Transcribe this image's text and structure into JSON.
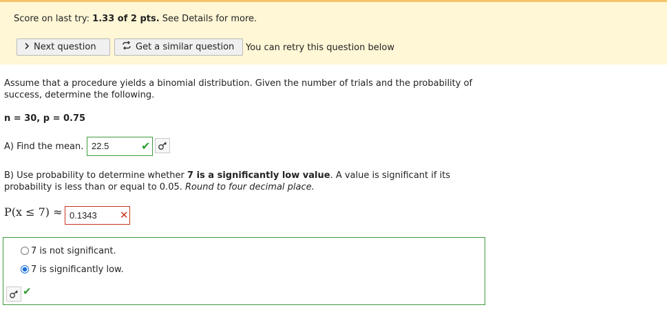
{
  "banner": {
    "score_prefix": "Score on last try:",
    "score_value": "1.33 of 2 pts.",
    "score_suffix": "See Details for more.",
    "next_label": "Next question",
    "similar_label": "Get a similar question",
    "retry_text": "You can retry this question below"
  },
  "question": {
    "intro": "Assume that a procedure yields a binomial distribution. Given the number of trials and the probability of success, determine the following.",
    "params": "n = 30, p = 0.75",
    "partA_label": "A) Find the mean.",
    "partA_value": "22.5",
    "partB_prefix": "B) Use probability to determine whether ",
    "partB_bold": "7 is a significantly low value",
    "partB_mid": ". A value is significant if its probability is less than or equal to 0.05. ",
    "partB_italic": "Round to four decimal place.",
    "prob_expr": "P(x ≤ 7) ≈",
    "partB_value": "0.1343",
    "choices": [
      {
        "label": "7 is not significant.",
        "selected": false
      },
      {
        "label": "7 is significantly low.",
        "selected": true
      }
    ]
  },
  "colors": {
    "correct": "#3b9a3b",
    "incorrect": "#c8331f",
    "banner": "#fff7d6"
  },
  "icons": {
    "next": "chevron-right-icon",
    "similar": "refresh-icon",
    "key": "key-icon",
    "check": "check-icon",
    "cross": "cross-icon"
  }
}
